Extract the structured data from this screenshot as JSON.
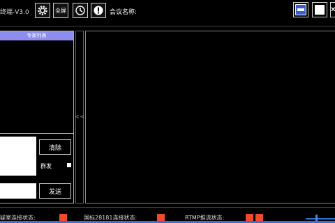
{
  "toolbar": {
    "app_title": "终端-V3.0",
    "fullscreen_label": "全屏",
    "meeting_name_label": "会议名称:"
  },
  "left_panel": {
    "expert_list_header": "专家列表",
    "clear_button": "清除",
    "group_send_label": "群发",
    "send_button": "发送"
  },
  "collapse_handle": "<<",
  "status_bar": {
    "consult_room_status": "疑室连接状态:",
    "gb28181_status": "国标28181连接状态:",
    "rtmp_status": "RTMP推流状态:",
    "volume_level": 0.35
  },
  "colors": {
    "status_indicator": "#ef4a2e",
    "expert_header_bg": "#8d8df0",
    "accent_blue": "#3a6fd8"
  }
}
